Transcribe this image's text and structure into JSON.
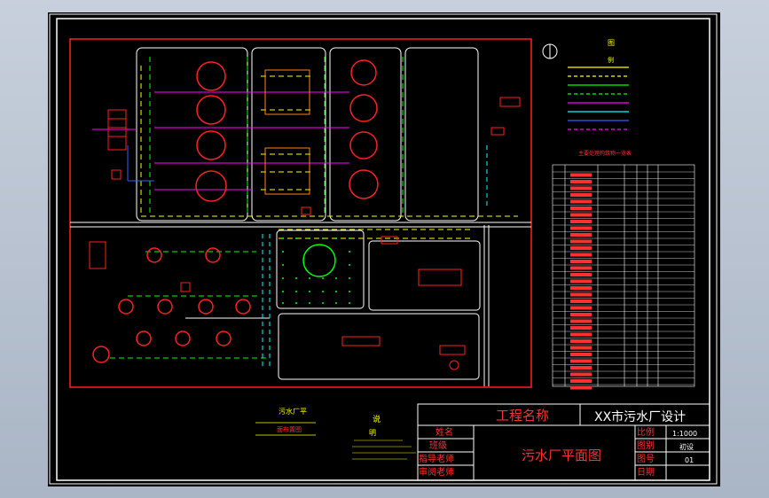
{
  "drawing": {
    "title_block": {
      "project_label": "工程名称",
      "project_name": "XX市污水厂设计",
      "drawing_name": "污水厂平面图",
      "rows_left": [
        "姓名",
        "班级",
        "指导老师",
        "审阅老师"
      ],
      "rows_mid": [
        "比例",
        "图别",
        "图号",
        "日期"
      ],
      "scale_value": "1:1000",
      "category_value": "初设",
      "number_value": "01"
    },
    "plan_caption": {
      "title": "污水厂平",
      "subtitle": "面布置图"
    },
    "notes": {
      "title": "说",
      "title2": "明"
    },
    "legend": {
      "title": "图",
      "title2": "例"
    },
    "structure_table": {
      "title": "主要处理构筑物一览表"
    }
  },
  "colors": {
    "border": "#ffffff",
    "site_boundary": "#ff2020",
    "road": "#ffffff",
    "sewage_pipe": "#ffff00",
    "sludge_pipe": "#00ff00",
    "air_pipe": "#ff00ff",
    "return_pipe": "#00ffff",
    "water_pipe": "#3060ff",
    "tank": "#ff2020",
    "text_yellow": "#ffff00",
    "text_red": "#ff3030"
  }
}
